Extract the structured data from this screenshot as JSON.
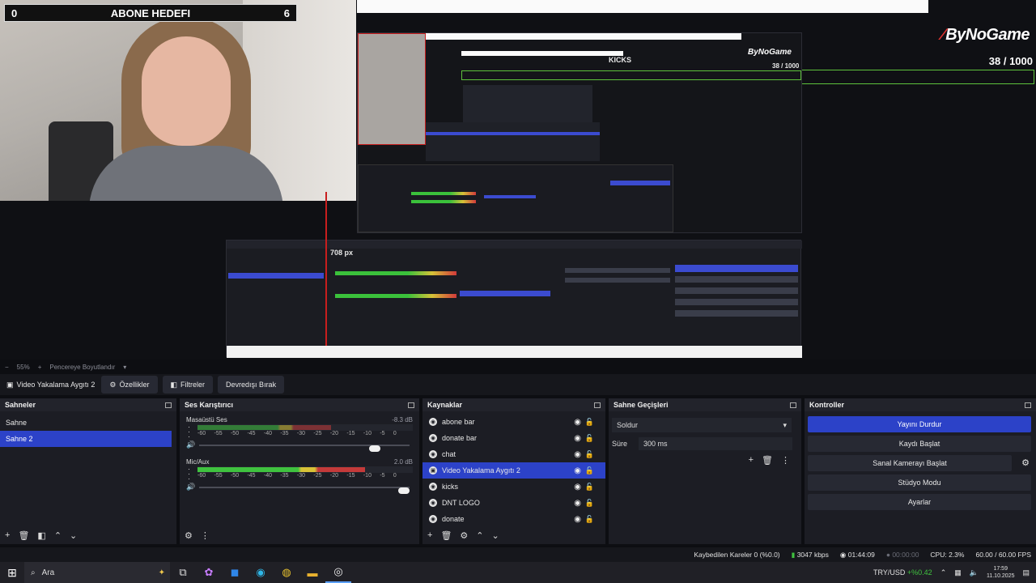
{
  "overlay": {
    "goal_left": "0",
    "goal_title": "ABONE HEDEFI",
    "goal_right": "6",
    "brand": "ByNoGame",
    "brand_count": "38  / 1000",
    "ghost_kicks": "KICKS",
    "ghost_brand": "ByNoGame",
    "ghost_count": "38  / 1000",
    "ghost_px": "708 px"
  },
  "zoom_strip": {
    "zoom": "55%",
    "fit_label": "Pencereye Boyutlandır"
  },
  "source_toolbar": {
    "selected_source": "Video Yakalama Aygıtı 2",
    "properties": "Özellikler",
    "filters": "Filtreler",
    "deactivate": "Devredışı Bırak"
  },
  "docks": {
    "scenes": {
      "title": "Sahneler",
      "items": [
        {
          "label": "Sahne",
          "selected": false
        },
        {
          "label": "Sahne 2",
          "selected": true
        }
      ]
    },
    "mixer": {
      "title": "Ses Karıştırıcı",
      "channels": [
        {
          "name": "Masaüstü Ses",
          "db": "-8.3 dB",
          "level": 0.62,
          "volume": 0.86
        },
        {
          "name": "Mic/Aux",
          "db": "2.0 dB",
          "level": 0.78,
          "volume": 1.0
        }
      ],
      "ticks": [
        "-60",
        "-55",
        "-50",
        "-45",
        "-40",
        "-35",
        "-30",
        "-25",
        "-20",
        "-15",
        "-10",
        "-5",
        "0"
      ]
    },
    "sources": {
      "title": "Kaynaklar",
      "items": [
        {
          "label": "abone bar",
          "selected": false
        },
        {
          "label": "donate bar",
          "selected": false
        },
        {
          "label": "chat",
          "selected": false
        },
        {
          "label": "Video Yakalama Aygıtı 2",
          "selected": true
        },
        {
          "label": "kicks",
          "selected": false
        },
        {
          "label": "DNT LOGO",
          "selected": false
        },
        {
          "label": "donate",
          "selected": false
        }
      ]
    },
    "transitions": {
      "title": "Sahne Geçişleri",
      "selected": "Soldur",
      "duration_label": "Süre",
      "duration_value": "300 ms"
    },
    "controls": {
      "title": "Kontroller",
      "stop_stream": "Yayını Durdur",
      "start_recording": "Kaydı Başlat",
      "virtual_cam": "Sanal Kamerayı Başlat",
      "studio_mode": "Stüdyo Modu",
      "settings": "Ayarlar"
    }
  },
  "obs_status": {
    "dropped": "Kaybedilen Kareler 0 (%0.0)",
    "bitrate": "3047 kbps",
    "stream_time": "01:44:09",
    "rec_time": "00:00:00",
    "cpu": "CPU: 2.3%",
    "fps": "60.00 / 60.00 FPS"
  },
  "taskbar": {
    "search": "Ara",
    "currency": "TRY/USD",
    "change": "+%0.42",
    "time": "17:59",
    "date": "11.10.2025"
  },
  "colors": {
    "accent": "#2c42c8",
    "meter_green": "#3fc23f",
    "meter_yellow": "#d8c237",
    "meter_red": "#c43a3a",
    "overlay_green": "#5ec23c"
  }
}
